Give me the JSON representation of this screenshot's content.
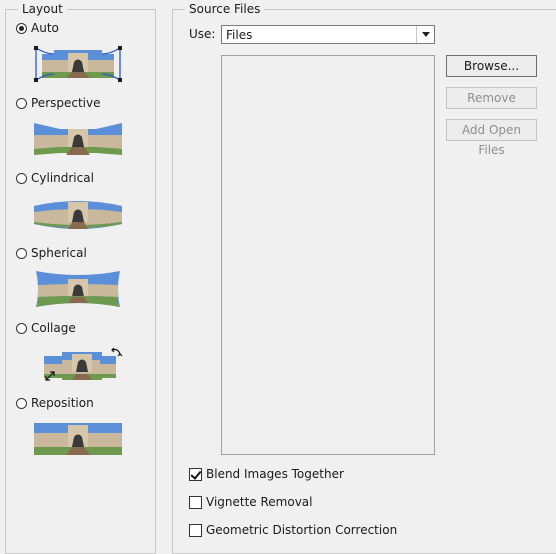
{
  "layout": {
    "title": "Layout",
    "options": [
      {
        "label": "Auto",
        "selected": true
      },
      {
        "label": "Perspective",
        "selected": false
      },
      {
        "label": "Cylindrical",
        "selected": false
      },
      {
        "label": "Spherical",
        "selected": false
      },
      {
        "label": "Collage",
        "selected": false
      },
      {
        "label": "Reposition",
        "selected": false
      }
    ]
  },
  "source_files": {
    "title": "Source Files",
    "use_label": "Use:",
    "use_value": "Files",
    "buttons": {
      "browse": "Browse...",
      "remove": "Remove",
      "add_open_files": "Add Open Files"
    }
  },
  "options": {
    "blend_images": {
      "label": "Blend Images Together",
      "checked": true
    },
    "vignette_removal": {
      "label": "Vignette Removal",
      "checked": false
    },
    "geometric_distortion": {
      "label": "Geometric Distortion Correction",
      "checked": false
    }
  },
  "colors": {
    "sky": "#5b8fd8",
    "grass": "#6e9a4f",
    "building": "#c9b89b",
    "path": "#8a6a4e",
    "handle": "#2a57c9"
  }
}
